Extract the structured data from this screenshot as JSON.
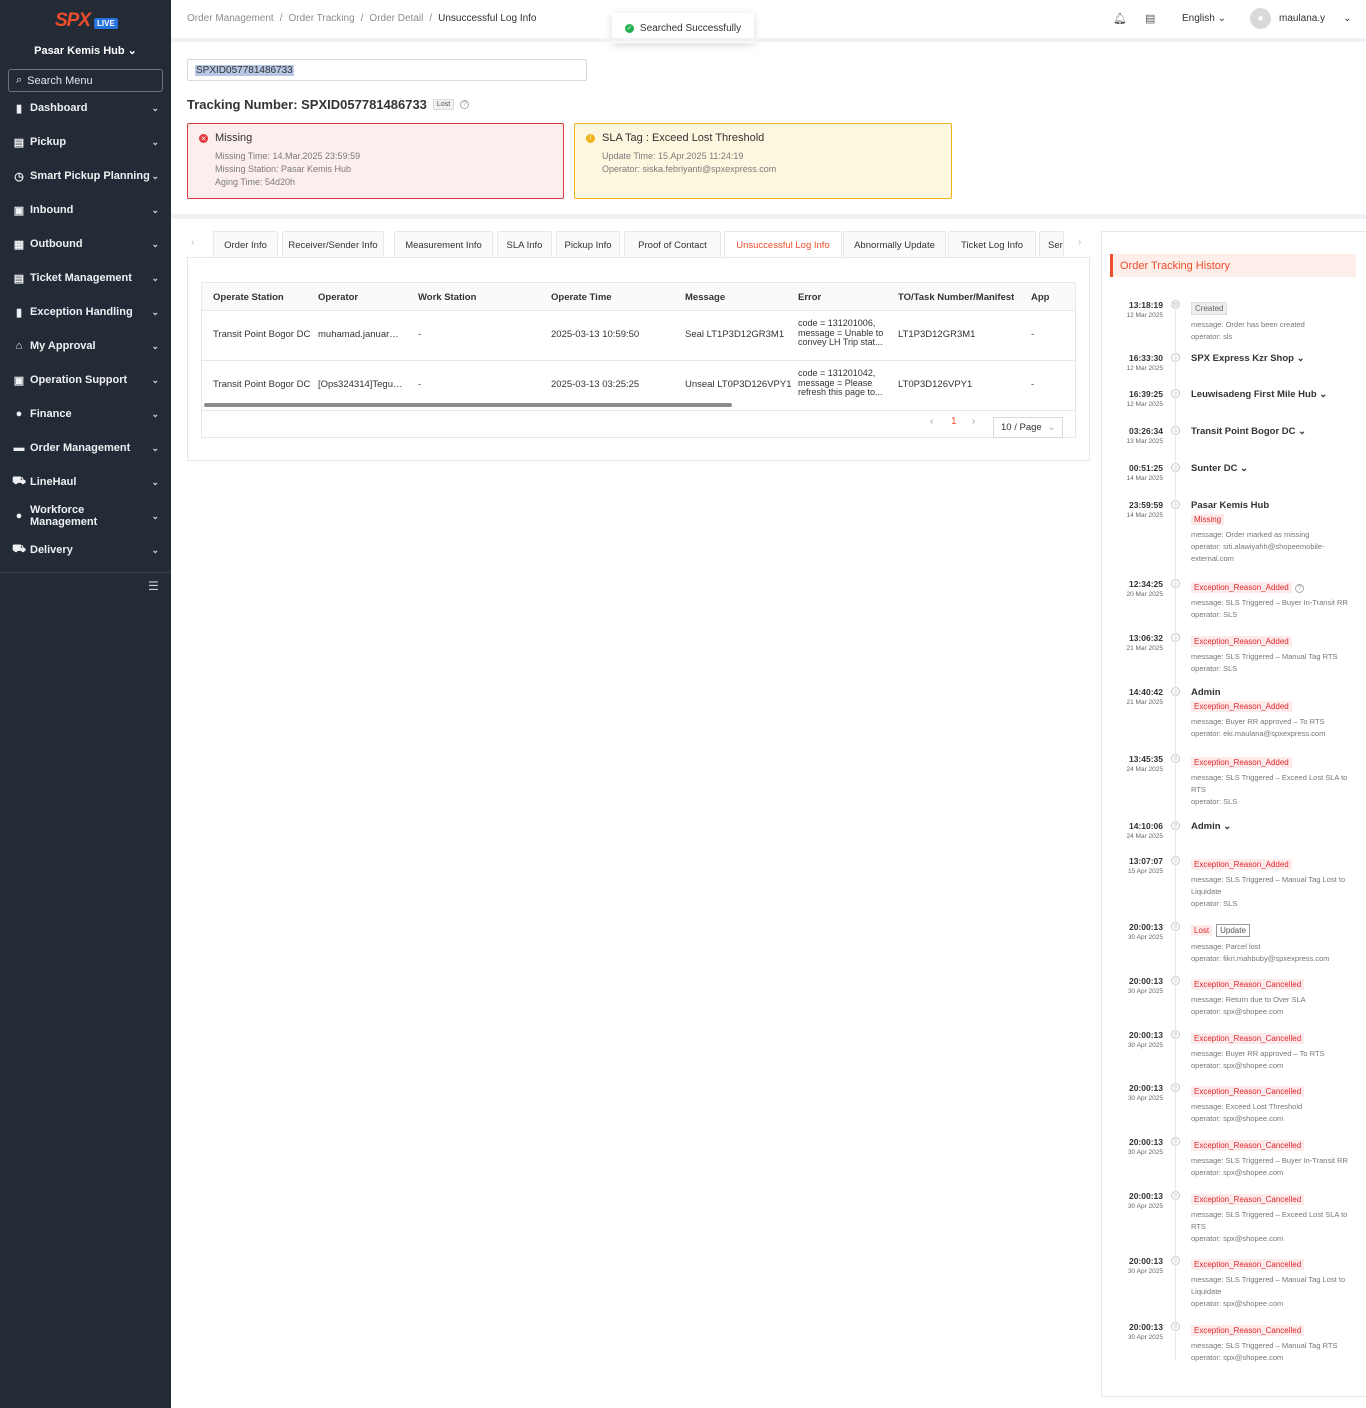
{
  "sidebar": {
    "logo": "SPX",
    "badge": "LIVE",
    "hub": "Pasar Kemis Hub",
    "search_placeholder": "Search Menu",
    "items": [
      {
        "label": "Dashboard",
        "icon": "dashboard-icon"
      },
      {
        "label": "Pickup",
        "icon": "pickup-icon"
      },
      {
        "label": "Smart Pickup Planning",
        "icon": "clock-icon"
      },
      {
        "label": "Inbound",
        "icon": "inbound-icon"
      },
      {
        "label": "Outbound",
        "icon": "outbound-icon"
      },
      {
        "label": "Ticket Management",
        "icon": "ticket-icon"
      },
      {
        "label": "Exception Handling",
        "icon": "exception-icon"
      },
      {
        "label": "My Approval",
        "icon": "home-icon"
      },
      {
        "label": "Operation Support",
        "icon": "gift-icon"
      },
      {
        "label": "Finance",
        "icon": "finance-icon"
      },
      {
        "label": "Order Management",
        "icon": "order-icon"
      },
      {
        "label": "LineHaul",
        "icon": "truck-icon"
      },
      {
        "label": "Workforce Management",
        "icon": "user-icon"
      },
      {
        "label": "Delivery",
        "icon": "delivery-truck-icon"
      }
    ]
  },
  "header": {
    "breadcrumb": [
      "Order Management",
      "Order Tracking",
      "Order Detail",
      "Unsuccessful Log Info"
    ],
    "toast": "Searched Successfully",
    "language": "English",
    "username": "maulana.y"
  },
  "search": {
    "value": "SPXID057781486733"
  },
  "tracking": {
    "title": "Tracking Number: SPXID057781486733",
    "badge": "Lost"
  },
  "alerts": {
    "missing": {
      "title": "Missing",
      "lines": [
        "Missing Time: 14.Mar.2025 23:59:59",
        "Missing Station: Pasar Kemis Hub",
        "Aging Time: 54d20h"
      ]
    },
    "sla": {
      "title": "SLA Tag : Exceed Lost Threshold",
      "lines": [
        "Update Time: 15.Apr.2025 11:24:19",
        "Operator: siska.febriyanti@spxexpress.com"
      ]
    }
  },
  "tabs": [
    "Order Info",
    "Receiver/Sender Info",
    "Measurement Info",
    "SLA Info",
    "Pickup Info",
    "Proof of Contact",
    "Unsuccessful Log Info",
    "Abnormally Update",
    "Ticket Log Info",
    "Ser"
  ],
  "active_tab": "Unsuccessful Log Info",
  "table": {
    "columns": [
      "Operate Station",
      "Operator",
      "Work Station",
      "Operate Time",
      "Message",
      "Error",
      "TO/Task Number/Manifest",
      "App"
    ],
    "rows": [
      [
        "Transit Point Bogor DC",
        "muhamad.januar@...",
        "-",
        "2025-03-13 10:59:50",
        "Seal LT1P3D12GR3M1",
        "code = 131201006, message = Unable to convey LH Trip stat...",
        "LT1P3D12GR3M1",
        "-"
      ],
      [
        "Transit Point Bogor DC",
        "[Ops324314]Teguh ...",
        "-",
        "2025-03-13 03:25:25",
        "Unseal LT0P3D126VPY1",
        "code = 131201042, message = Please refresh this page to...",
        "LT0P3D126VPY1",
        "-"
      ]
    ],
    "page": "1",
    "page_size": "10 / Page"
  },
  "history": {
    "title": "Order Tracking History",
    "events": [
      {
        "time": "13:18:19",
        "date": "12 Mar 2025",
        "loc": "",
        "tags": [
          "Created"
        ],
        "msg": [
          "message: Order has been created",
          "operator: sls"
        ]
      },
      {
        "time": "16:33:30",
        "date": "12 Mar 2025",
        "loc": "SPX Express Kzr Shop",
        "tags": [],
        "msg": []
      },
      {
        "time": "16:39:25",
        "date": "12 Mar 2025",
        "loc": "Leuwisadeng First Mile Hub",
        "tags": [],
        "msg": []
      },
      {
        "time": "03:26:34",
        "date": "13 Mar 2025",
        "loc": "Transit Point Bogor DC",
        "tags": [],
        "msg": []
      },
      {
        "time": "00:51:25",
        "date": "14 Mar 2025",
        "loc": "Sunter DC",
        "tags": [],
        "msg": []
      },
      {
        "time": "23:59:59",
        "date": "14 Mar 2025",
        "loc": "Pasar Kemis Hub",
        "tags": [
          "Missing"
        ],
        "msg": [
          "message: Order marked as missing",
          "operator: siti.alawiyahh@shopeemobile-external.com"
        ]
      },
      {
        "time": "12:34:25",
        "date": "20 Mar 2025",
        "loc": "",
        "tags": [
          "Exception_Reason_Added"
        ],
        "msg": [
          "message: SLS Triggered – Buyer In-Transit RR",
          "operator: SLS"
        ]
      },
      {
        "time": "13:06:32",
        "date": "21 Mar 2025",
        "loc": "",
        "tags": [
          "Exception_Reason_Added"
        ],
        "msg": [
          "message: SLS Triggered – Manual Tag RTS",
          "operator: SLS"
        ]
      },
      {
        "time": "14:40:42",
        "date": "21 Mar 2025",
        "loc": "Admin",
        "tags": [
          "Exception_Reason_Added"
        ],
        "msg": [
          "message: Buyer RR approved – To RTS",
          "operator: eki.maulana@spxexpress.com"
        ]
      },
      {
        "time": "13:45:35",
        "date": "24 Mar 2025",
        "loc": "",
        "tags": [
          "Exception_Reason_Added"
        ],
        "msg": [
          "message: SLS Triggered – Exceed Lost SLA to RTS",
          "operator: SLS"
        ]
      },
      {
        "time": "14:10:06",
        "date": "24 Mar 2025",
        "loc": "Admin",
        "tags": [],
        "msg": []
      },
      {
        "time": "13:07:07",
        "date": "15 Apr 2025",
        "loc": "",
        "tags": [
          "Exception_Reason_Added"
        ],
        "msg": [
          "message: SLS Triggered – Manual Tag Lost to Liquidate",
          "operator: SLS"
        ]
      },
      {
        "time": "20:00:13",
        "date": "30 Apr 2025",
        "loc": "",
        "tags": [
          "Lost",
          "Update"
        ],
        "msg": [
          "message: Parcel lost",
          "operator: fikri.mahbuby@spxexpress.com"
        ]
      },
      {
        "time": "20:00:13",
        "date": "30 Apr 2025",
        "loc": "",
        "tags": [
          "Exception_Reason_Cancelled"
        ],
        "msg": [
          "message: Return due to Over SLA",
          "operator: spx@shopee.com"
        ]
      },
      {
        "time": "20:00:13",
        "date": "30 Apr 2025",
        "loc": "",
        "tags": [
          "Exception_Reason_Cancelled"
        ],
        "msg": [
          "message: Buyer RR approved – To RTS",
          "operator: spx@shopee.com"
        ]
      },
      {
        "time": "20:00:13",
        "date": "30 Apr 2025",
        "loc": "",
        "tags": [
          "Exception_Reason_Cancelled"
        ],
        "msg": [
          "message: Exceed Lost Threshold",
          "operator: spx@shopee.com"
        ]
      },
      {
        "time": "20:00:13",
        "date": "30 Apr 2025",
        "loc": "",
        "tags": [
          "Exception_Reason_Cancelled"
        ],
        "msg": [
          "message: SLS Triggered – Buyer In-Transit RR",
          "operator: spx@shopee.com"
        ]
      },
      {
        "time": "20:00:13",
        "date": "30 Apr 2025",
        "loc": "",
        "tags": [
          "Exception_Reason_Cancelled"
        ],
        "msg": [
          "message: SLS Triggered – Exceed Lost SLA to RTS",
          "operator: spx@shopee.com"
        ]
      },
      {
        "time": "20:00:13",
        "date": "30 Apr 2025",
        "loc": "",
        "tags": [
          "Exception_Reason_Cancelled"
        ],
        "msg": [
          "message: SLS Triggered – Manual Tag Lost to Liquidate",
          "operator: spx@shopee.com"
        ]
      },
      {
        "time": "20:00:13",
        "date": "30 Apr 2025",
        "loc": "",
        "tags": [
          "Exception_Reason_Cancelled"
        ],
        "msg": [
          "message: SLS Triggered – Manual Tag RTS",
          "operator: spx@shopee.com"
        ]
      }
    ]
  },
  "colors": {
    "sidebar": "#232b36",
    "accent": "#ee4d2d",
    "success": "#22b14c",
    "danger": "#e0383e",
    "warning": "#f2b21c"
  }
}
